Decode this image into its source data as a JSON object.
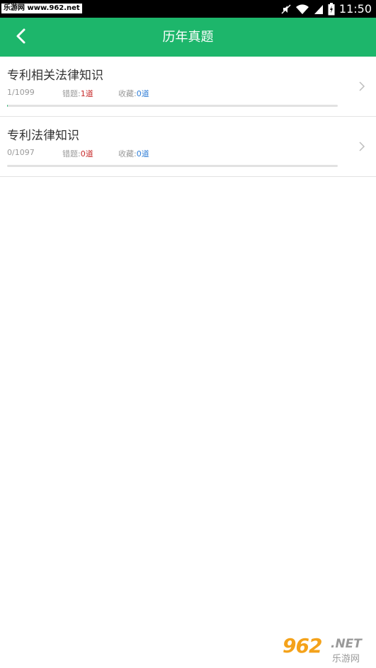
{
  "status_bar": {
    "watermark": "乐游网 www.962.net",
    "time": "11:50",
    "icons": [
      "mute-icon",
      "wifi-icon",
      "signal-icon",
      "battery-icon"
    ]
  },
  "header": {
    "title": "历年真题",
    "back_icon": "chevron-left-icon"
  },
  "colors": {
    "accent": "#1db66b",
    "wrong_value": "#c62828",
    "fav_value": "#2e7dd6"
  },
  "items": [
    {
      "title": "专利相关法律知识",
      "progress": "1/1099",
      "progress_fraction": 0.0009,
      "wrong_label": "错题:",
      "wrong_value": "1道",
      "fav_label": "收藏:",
      "fav_value": "0道"
    },
    {
      "title": "专利法律知识",
      "progress": "0/1097",
      "progress_fraction": 0.0,
      "wrong_label": "错题:",
      "wrong_value": "0道",
      "fav_label": "收藏:",
      "fav_value": "0道"
    }
  ],
  "watermark_logo": {
    "number": "962",
    "domain": ".NET",
    "cn": "乐游网"
  }
}
